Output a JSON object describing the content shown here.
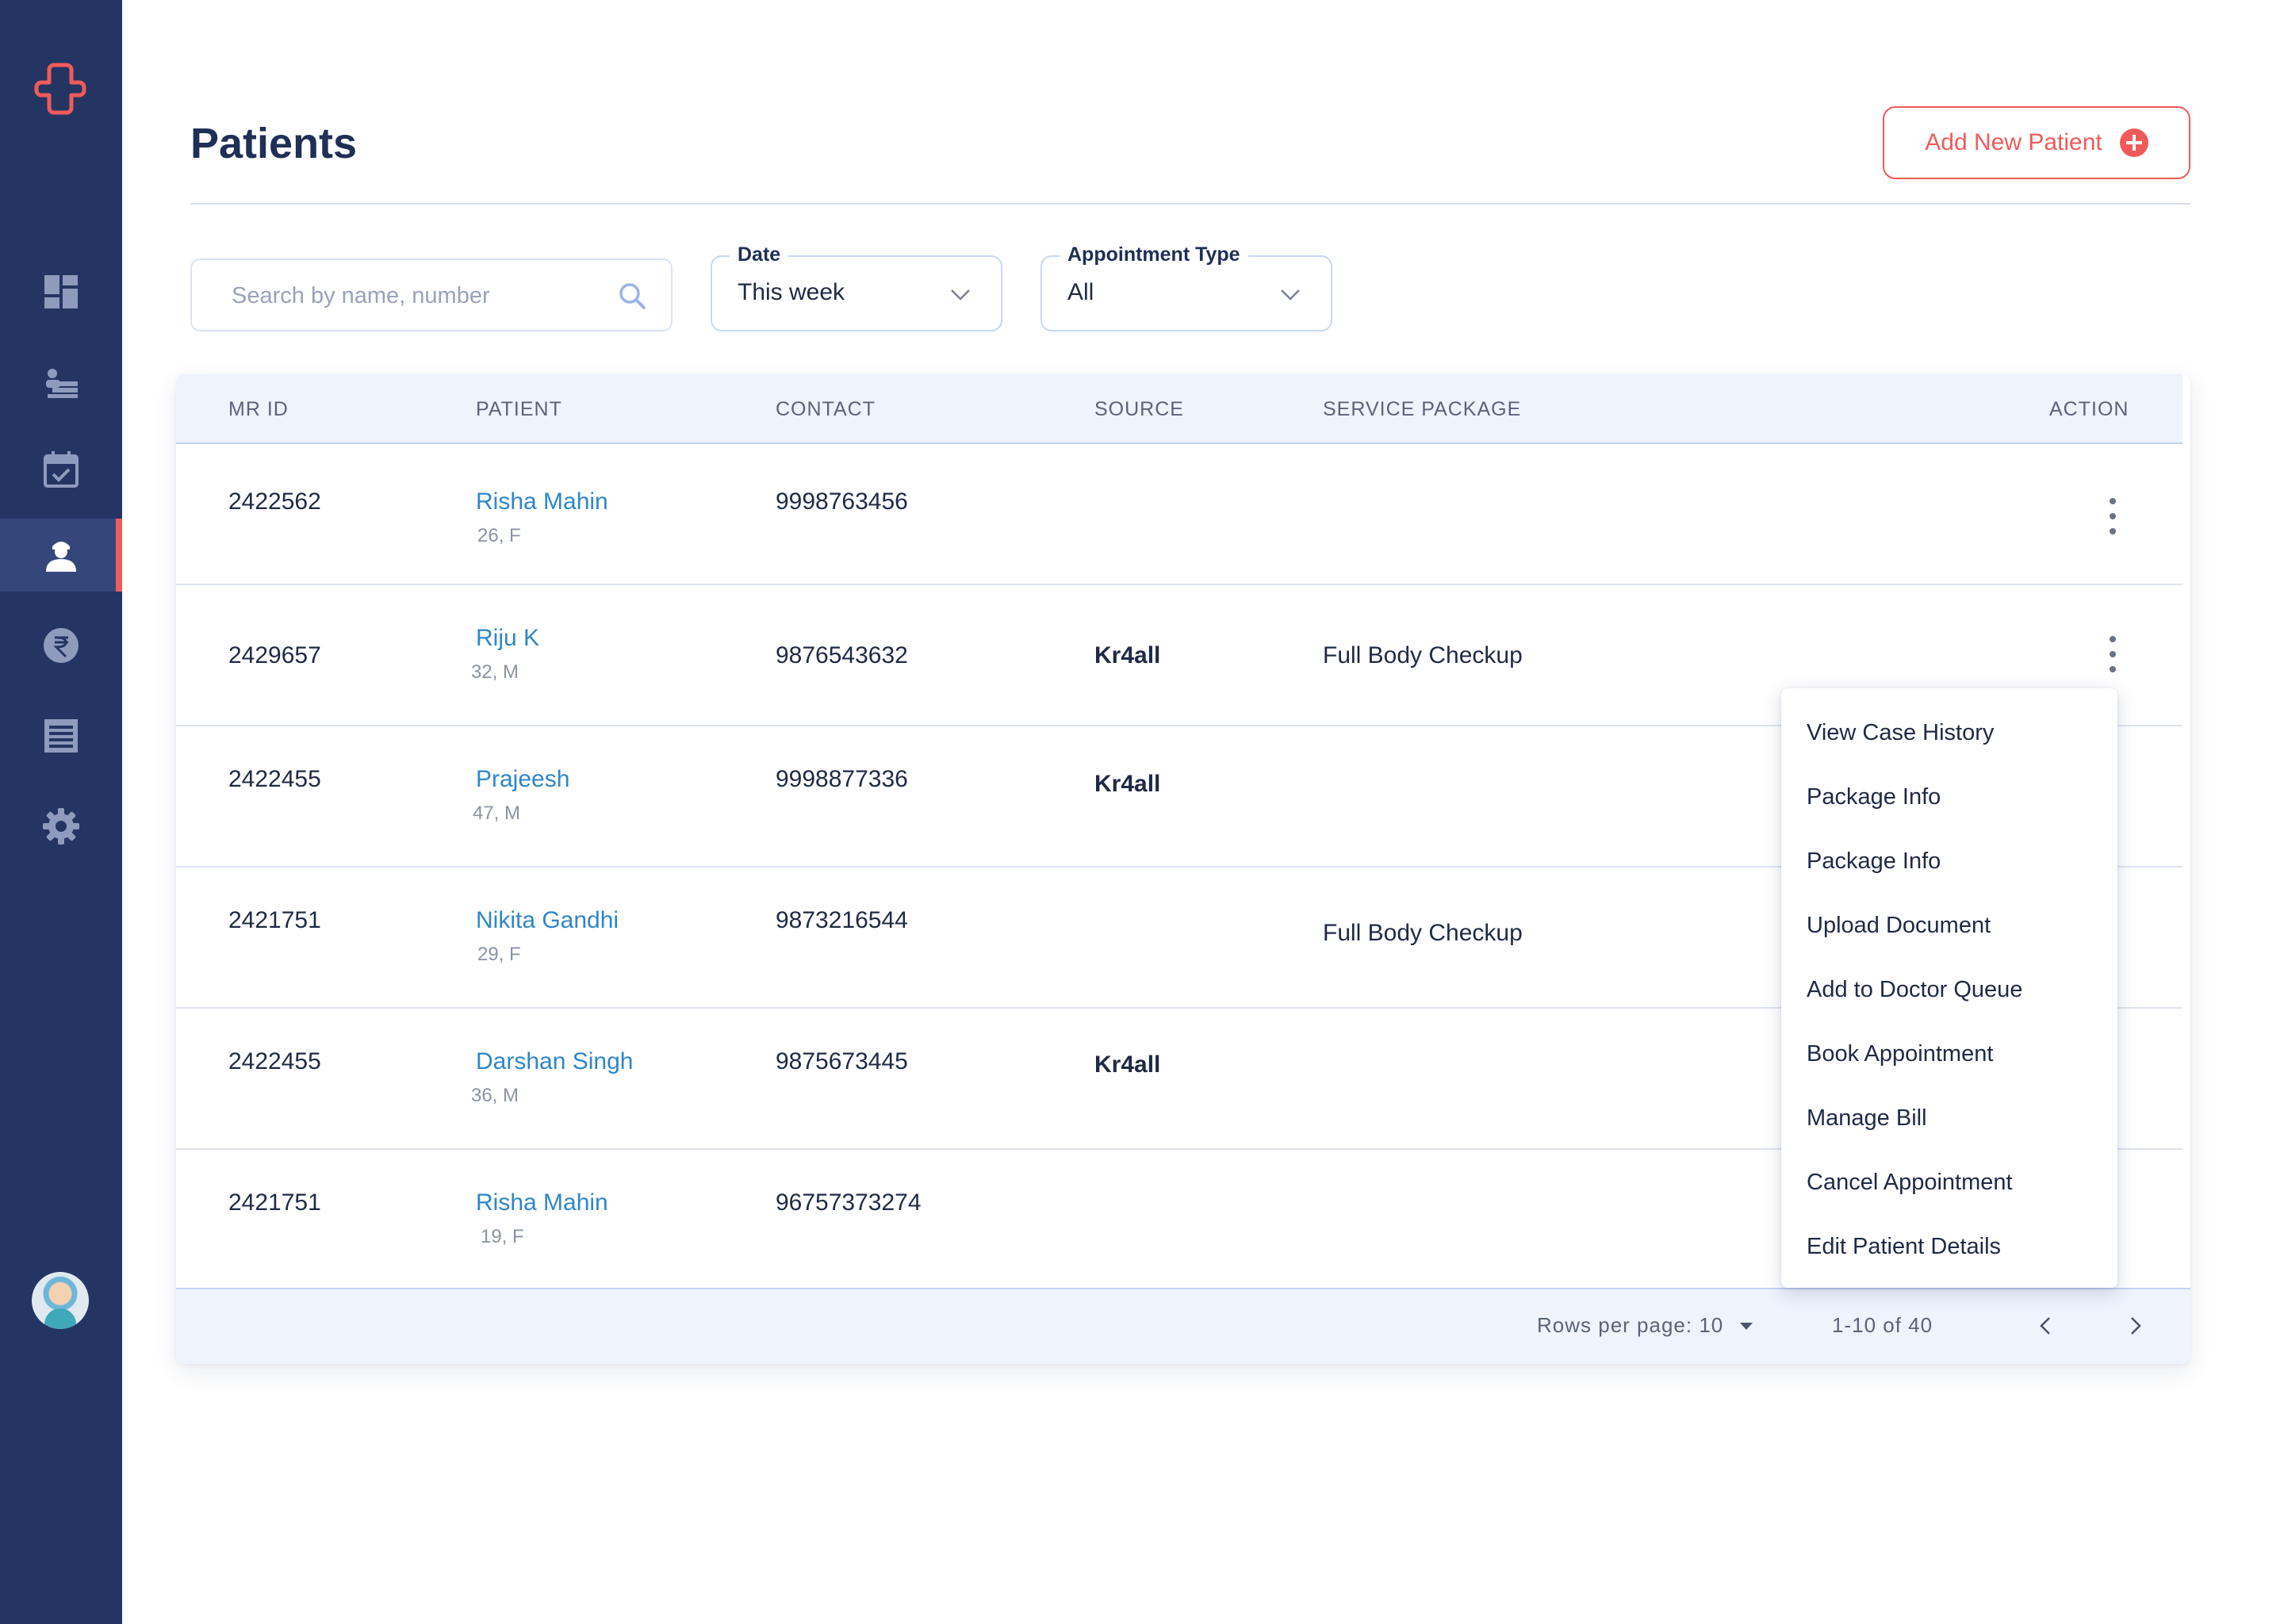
{
  "page": {
    "title": "Patients",
    "add_button_label": "Add New Patient"
  },
  "filters": {
    "search_placeholder": "Search by name, number",
    "date": {
      "label": "Date",
      "value": "This week"
    },
    "appointment_type": {
      "label": "Appointment Type",
      "value": "All"
    }
  },
  "table": {
    "headers": {
      "mr_id": "MR ID",
      "patient": "PATIENT",
      "contact": "CONTACT",
      "source": "SOURCE",
      "service_package": "SERVICE PACKAGE",
      "action": "ACTION"
    },
    "rows": [
      {
        "mr_id": "2422562",
        "name": "Risha Mahin",
        "meta": "26, F",
        "contact": "9998763456",
        "source": "",
        "package": ""
      },
      {
        "mr_id": "2429657",
        "name": "Riju K",
        "meta": "32, M",
        "contact": "9876543632",
        "source": "Kr4all",
        "package": "Full Body Checkup"
      },
      {
        "mr_id": "2422455",
        "name": "Prajeesh",
        "meta": "47, M",
        "contact": "9998877336",
        "source": "Kr4all",
        "package": ""
      },
      {
        "mr_id": "2421751",
        "name": "Nikita Gandhi",
        "meta": "29, F",
        "contact": "9873216544",
        "source": "",
        "package": "Full Body Checkup"
      },
      {
        "mr_id": "2422455",
        "name": "Darshan Singh",
        "meta": "36, M",
        "contact": "9875673445",
        "source": "Kr4all",
        "package": ""
      },
      {
        "mr_id": "2421751",
        "name": "Risha Mahin",
        "meta": "19, F",
        "contact": "96757373274",
        "source": "",
        "package": ""
      }
    ],
    "footer": {
      "rows_per_page": "Rows per page: 10",
      "range": "1-10 of 40"
    }
  },
  "action_menu": {
    "items": [
      "View Case History",
      "Package Info",
      "Package Info",
      "Upload Document",
      "Add to Doctor Queue",
      "Book Appointment",
      "Manage Bill",
      "Cancel Appointment",
      "Edit Patient Details"
    ]
  },
  "sidebar": {
    "items": [
      "dashboard-icon",
      "queue-icon",
      "calendar-check-icon",
      "patients-icon",
      "rupee-icon",
      "billing-list-icon",
      "settings-icon"
    ],
    "active_item": "patients-icon"
  },
  "colors": {
    "sidebar": "#253563",
    "accent": "#ef5b5b",
    "link": "#2f86c9",
    "header_bg": "#eef3fc"
  }
}
